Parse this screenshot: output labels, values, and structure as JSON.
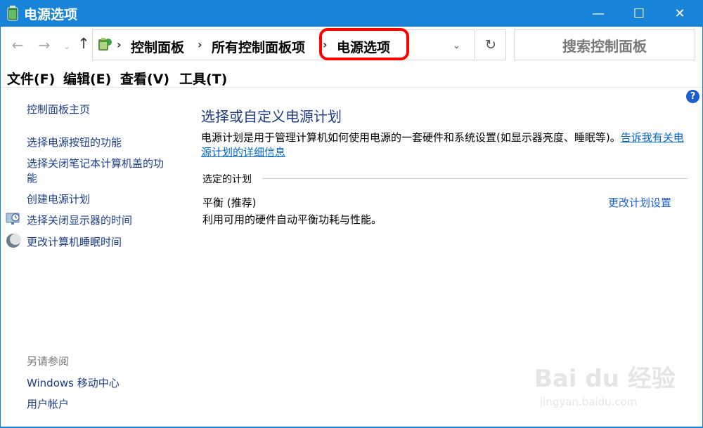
{
  "window": {
    "title": "电源选项",
    "minimize_glyph": "—",
    "maximize_glyph": "☐",
    "close_glyph": "✕",
    "accent_color": "#1883d7"
  },
  "nav": {
    "back_glyph": "←",
    "forward_glyph": "→",
    "recent_glyph": "⌄",
    "up_glyph": "↑"
  },
  "address": {
    "breadcrumbs": [
      "控制面板",
      "所有控制面板项",
      "电源选项"
    ],
    "separator": "›",
    "dropdown_glyph": "⌄",
    "refresh_glyph": "↻",
    "highlight_color": "#ff0000"
  },
  "search": {
    "placeholder": "搜索控制面板"
  },
  "menu": {
    "items": [
      "文件(F)",
      "编辑(E)",
      "查看(V)",
      "工具(T)"
    ]
  },
  "help": {
    "glyph": "?"
  },
  "sidebar": {
    "home": "控制面板主页",
    "links": [
      "选择电源按钮的功能",
      "选择关闭笔记本计算机盖的功",
      "能",
      "创建电源计划",
      "选择关闭显示器的时间",
      "更改计算机睡眠时间"
    ],
    "icons": [
      "monitor-clock-icon",
      "moon-icon"
    ],
    "see_also_title": "另请参阅",
    "see_also": [
      "Windows 移动中心",
      "用户帐户"
    ]
  },
  "main": {
    "title": "选择或自定义电源计划",
    "description": "电源计划是用于管理计算机如何使用电源的一套硬件和系统设置(如显示器亮度、睡眠等)。",
    "description_link_1": "告诉我有关电",
    "description_link_2": "源计划的详细信息",
    "group_label": "选定的计划",
    "plan_name": "平衡 (推荐)",
    "plan_description": "利用可用的硬件自动平衡功耗与性能。",
    "plan_link": "更改计划设置"
  },
  "watermark": {
    "top": "Bai du 经验",
    "bottom": "jingyan.baidu.com"
  }
}
